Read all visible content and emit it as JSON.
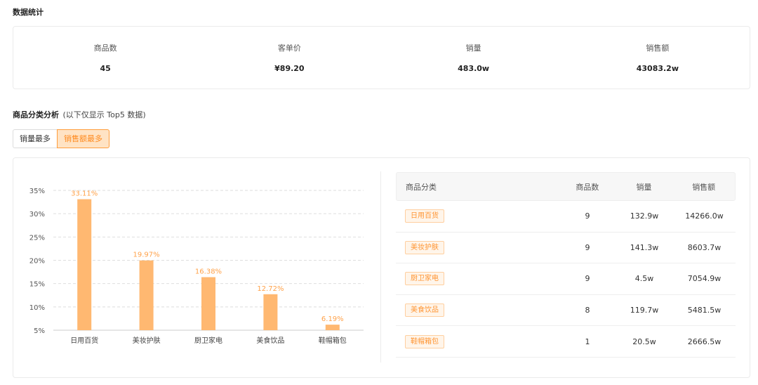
{
  "section_title": "数据统计",
  "stats": [
    {
      "label": "商品数",
      "value": "45"
    },
    {
      "label": "客单价",
      "value": "¥89.20"
    },
    {
      "label": "销量",
      "value": "483.0w"
    },
    {
      "label": "销售额",
      "value": "43083.2w"
    }
  ],
  "category_section": {
    "title": "商品分类分析",
    "note": "(以下仅显示 Top5 数据)"
  },
  "toggle": {
    "options": [
      "销量最多",
      "销售额最多"
    ],
    "selected": "销售额最多"
  },
  "colors": {
    "accent": "#ff9d3c",
    "bar": "#ffb871",
    "bar_label": "#ffa24a",
    "tag_text": "#ff9533",
    "tag_border": "#ffcf9f",
    "tag_bg": "#fff5ea"
  },
  "chart_data": {
    "type": "bar",
    "categories": [
      "日用百货",
      "美妆护肤",
      "厨卫家电",
      "美食饮品",
      "鞋帽箱包"
    ],
    "values": [
      33.11,
      19.97,
      16.38,
      12.72,
      6.19
    ],
    "value_labels": [
      "33.11%",
      "19.97%",
      "16.38%",
      "12.72%",
      "6.19%"
    ],
    "y_ticks": [
      "5%",
      "10%",
      "15%",
      "20%",
      "25%",
      "30%",
      "35%"
    ],
    "y_tick_values": [
      5,
      10,
      15,
      20,
      25,
      30,
      35
    ],
    "ylim": [
      5,
      35
    ],
    "grid": true,
    "grid_style": "dashed"
  },
  "table": {
    "headers": [
      "商品分类",
      "商品数",
      "销量",
      "销售额"
    ],
    "rows": [
      {
        "category": "日用百货",
        "count": "9",
        "sales": "132.9w",
        "revenue": "14266.0w"
      },
      {
        "category": "美妆护肤",
        "count": "9",
        "sales": "141.3w",
        "revenue": "8603.7w"
      },
      {
        "category": "厨卫家电",
        "count": "9",
        "sales": "4.5w",
        "revenue": "7054.9w"
      },
      {
        "category": "美食饮品",
        "count": "8",
        "sales": "119.7w",
        "revenue": "5481.5w"
      },
      {
        "category": "鞋帽箱包",
        "count": "1",
        "sales": "20.5w",
        "revenue": "2666.5w"
      }
    ]
  }
}
